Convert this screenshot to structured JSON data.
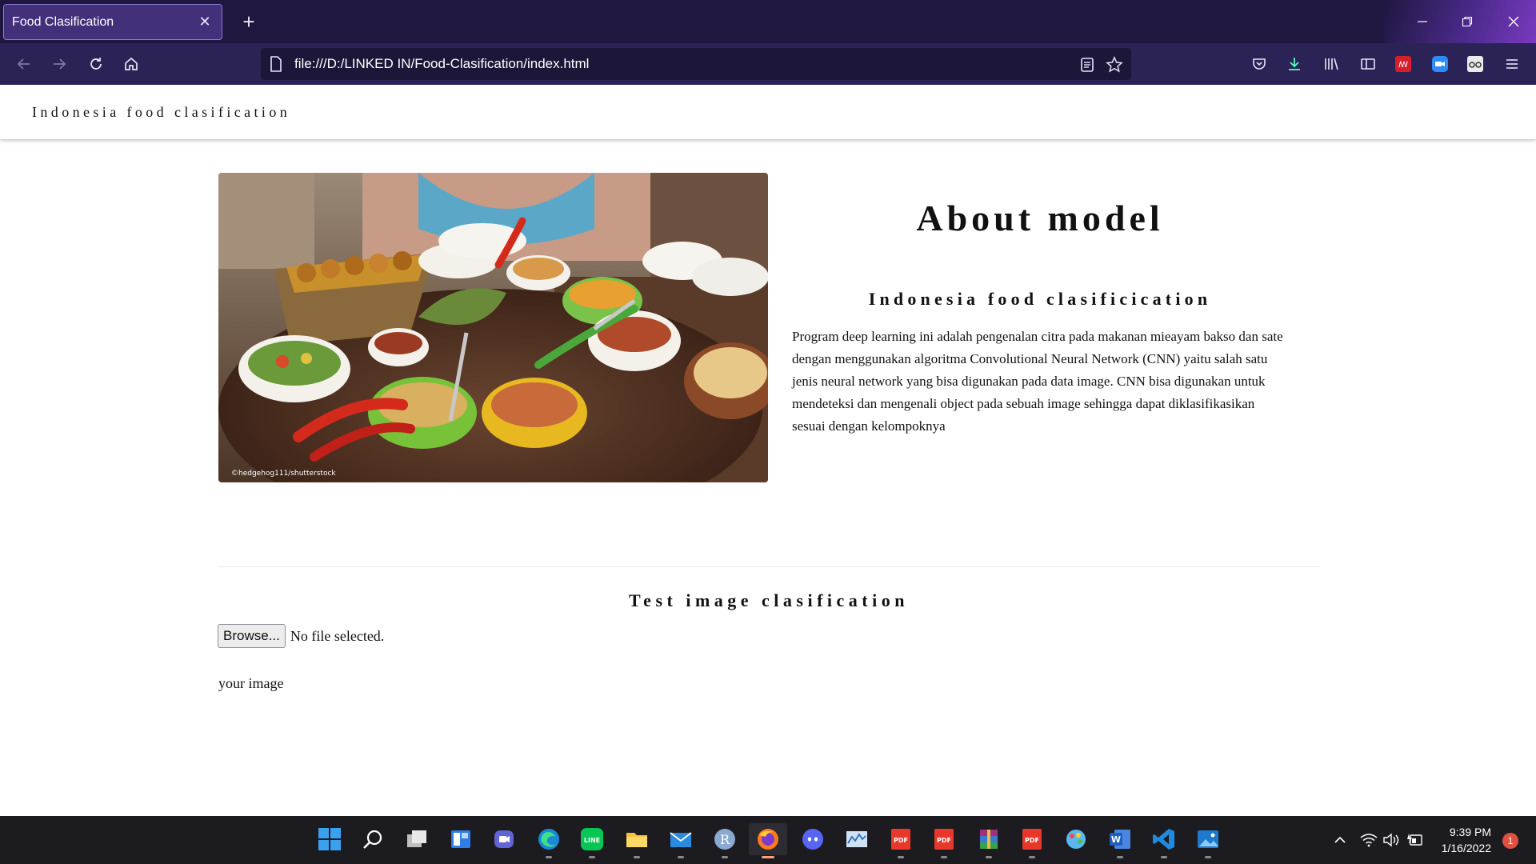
{
  "browser": {
    "tab_title": "Food Clasification",
    "url": "file:///D:/LINKED IN/Food-Clasification/index.html"
  },
  "site": {
    "brand": "Indonesia food clasification"
  },
  "about": {
    "title": "About model",
    "subtitle": "Indonesia food clasificication",
    "body": "Program deep learning ini adalah pengenalan citra pada makanan mieayam bakso dan sate dengan menggunakan algoritma Convolutional Neural Network (CNN) yaitu salah satu jenis neural network yang bisa digunakan pada data image. CNN bisa digunakan untuk mendeteksi dan mengenali object pada sebuah image sehingga dapat diklasifikasikan sesuai dengan kelompoknya",
    "image_credit": "©hedgehog111/shutterstock"
  },
  "test": {
    "title": "Test image clasification",
    "browse_label": "Browse...",
    "file_status": "No file selected.",
    "your_image_label": "your image"
  },
  "taskbar": {
    "time": "9:39 PM",
    "date": "1/16/2022",
    "notification_count": "1",
    "pinned_apps": [
      "start-icon",
      "search-icon",
      "task-view-icon",
      "widgets-icon",
      "chat-icon",
      "edge-icon",
      "line-icon",
      "file-explorer-icon",
      "mail-icon",
      "r-icon",
      "firefox-icon",
      "discord-icon",
      "monitor-app-icon",
      "pdf-icon",
      "pdf-icon",
      "winrar-icon",
      "pdf-icon",
      "paint-icon",
      "word-icon",
      "vscode-icon",
      "photos-icon"
    ]
  }
}
